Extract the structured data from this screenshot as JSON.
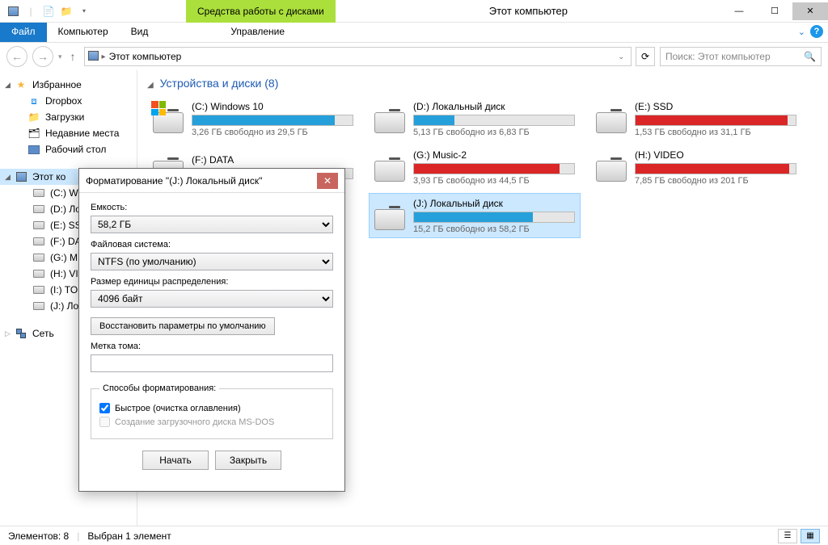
{
  "window": {
    "title": "Этот компьютер",
    "disk_tools_label": "Средства работы с дисками"
  },
  "ribbon": {
    "file": "Файл",
    "computer": "Компьютер",
    "view": "Вид",
    "manage": "Управление"
  },
  "breadcrumb": {
    "location": "Этот компьютер"
  },
  "search": {
    "placeholder": "Поиск: Этот компьютер"
  },
  "sidebar": {
    "favorites": "Избранное",
    "fav_items": [
      {
        "label": "Dropbox"
      },
      {
        "label": "Загрузки"
      },
      {
        "label": "Недавние места"
      },
      {
        "label": "Рабочий стол"
      }
    ],
    "this_pc": "Этот ко",
    "pc_items": [
      {
        "label": "(C:) W"
      },
      {
        "label": "(D:) Ло"
      },
      {
        "label": "(E:) SS"
      },
      {
        "label": "(F:) DA"
      },
      {
        "label": "(G:) M"
      },
      {
        "label": "(H:) VI"
      },
      {
        "label": "(I:) TO"
      },
      {
        "label": "(J:) Ло"
      }
    ],
    "network": "Сеть"
  },
  "section": {
    "heading": "Устройства и диски (8)"
  },
  "drives": [
    {
      "name": "(C:) Windows 10",
      "free": "3,26 ГБ свободно из 29,5 ГБ",
      "fill_pct": 89,
      "color": "blue",
      "os": true
    },
    {
      "name": "(D:) Локальный диск",
      "free": "5,13 ГБ свободно из 6,83 ГБ",
      "fill_pct": 25,
      "color": "blue"
    },
    {
      "name": "(E:) SSD",
      "free": "1,53 ГБ свободно из 31,1 ГБ",
      "fill_pct": 95,
      "color": "red"
    },
    {
      "name": "(F:) DATA",
      "free": "",
      "fill_pct": 0,
      "color": "blue"
    },
    {
      "name": "(G:) Music-2",
      "free": "3,93 ГБ свободно из 44,5 ГБ",
      "fill_pct": 91,
      "color": "red"
    },
    {
      "name": "(H:) VIDEO",
      "free": "7,85 ГБ свободно из 201 ГБ",
      "fill_pct": 96,
      "color": "red"
    },
    {
      "name": "",
      "free": "",
      "fill_pct": 0,
      "color": "blue"
    },
    {
      "name": "(J:) Локальный диск",
      "free": "15,2 ГБ свободно из 58,2 ГБ",
      "fill_pct": 74,
      "color": "blue",
      "selected": true
    }
  ],
  "status": {
    "count": "Элементов: 8",
    "selection": "Выбран 1 элемент"
  },
  "dialog": {
    "title": "Форматирование \"(J:) Локальный диск\"",
    "capacity_label": "Емкость:",
    "capacity_value": "58,2 ГБ",
    "fs_label": "Файловая система:",
    "fs_value": "NTFS (по умолчанию)",
    "alloc_label": "Размер единицы распределения:",
    "alloc_value": "4096 байт",
    "restore_btn": "Восстановить параметры по умолчанию",
    "volume_label": "Метка тома:",
    "volume_value": "",
    "methods_legend": "Способы форматирования:",
    "quick_label": "Быстрое (очистка оглавления)",
    "msdos_label": "Создание загрузочного диска MS-DOS",
    "start_btn": "Начать",
    "close_btn": "Закрыть"
  }
}
